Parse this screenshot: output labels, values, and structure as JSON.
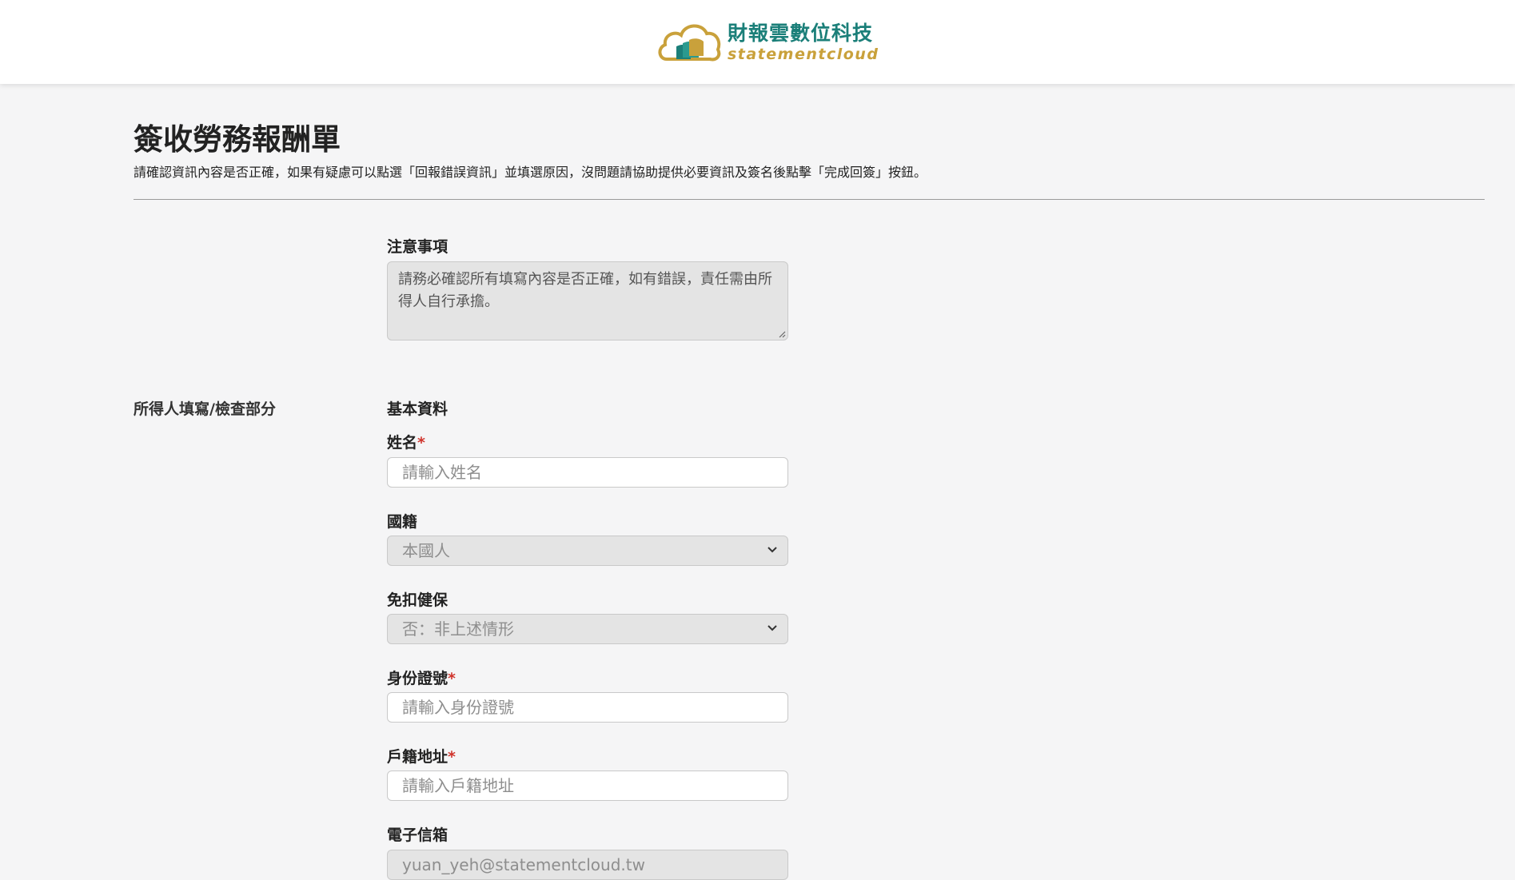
{
  "header": {
    "logo_cn": "財報雲數位科技",
    "logo_en": "statementcloud",
    "colors": {
      "brand_teal": "#1b7f79",
      "brand_gold": "#c9a13b"
    }
  },
  "page": {
    "title": "簽收勞務報酬單",
    "description": "請確認資訊內容是否正確，如果有疑慮可以點選「回報錯誤資訊」並填選原因，沒問題請協助提供必要資訊及簽名後點擊「完成回簽」按鈕。"
  },
  "notice": {
    "label": "注意事項",
    "text": "請務必確認所有填寫內容是否正確，如有錯誤，責任需由所得人自行承擔。"
  },
  "section": {
    "label": "所得人填寫/檢查部分",
    "subtitle": "基本資料"
  },
  "fields": {
    "name": {
      "label": "姓名",
      "required_mark": "*",
      "placeholder": "請輸入姓名"
    },
    "nationality": {
      "label": "國籍",
      "value": "本國人",
      "icon": "chevron-down-icon"
    },
    "health_exempt": {
      "label": "免扣健保",
      "value": "否：非上述情形",
      "icon": "chevron-down-icon"
    },
    "id_number": {
      "label": "身份證號",
      "required_mark": "*",
      "placeholder": "請輸入身份證號"
    },
    "address": {
      "label": "戶籍地址",
      "required_mark": "*",
      "placeholder": "請輸入戶籍地址"
    },
    "email": {
      "label": "電子信箱",
      "value": "yuan_yeh@statementcloud.tw"
    }
  }
}
